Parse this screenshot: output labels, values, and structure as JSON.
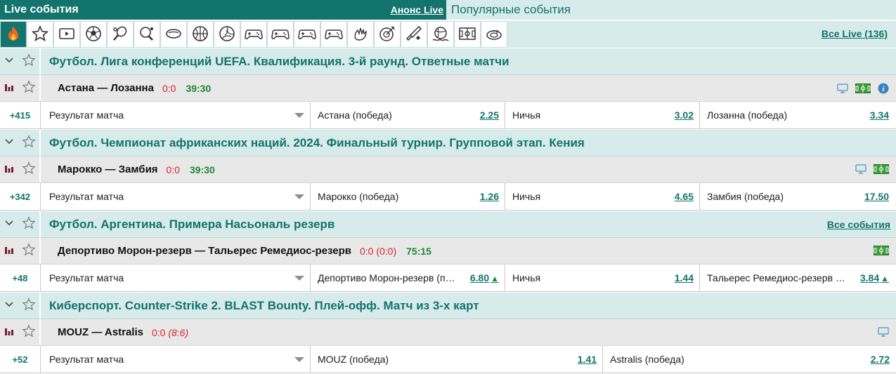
{
  "header": {
    "title": "Live события",
    "announce_link": "Анонс Live",
    "popular_title": "Популярные события"
  },
  "sports_bar": {
    "icons": [
      "fire-icon",
      "star-icon",
      "video-icon",
      "football-icon",
      "tennis-icon",
      "table-tennis-icon",
      "hockey-icon",
      "basketball-icon",
      "volleyball-icon",
      "esports-icon",
      "esports-icon",
      "esports-icon",
      "esports-icon",
      "handball-icon",
      "darts-icon",
      "cricket-icon",
      "water-polo-icon",
      "futsal-icon",
      "curling-icon"
    ],
    "all_live": "Все Live (136)"
  },
  "tournaments": [
    {
      "name": "Футбол. Лига конференций UEFA. Квалификация. 3-й раунд. Ответные матчи",
      "all_events": "",
      "match": {
        "teams": "Астана — Лозанна",
        "score": "0:0",
        "score_extra": "",
        "time": "39:30",
        "icons": [
          "tv-icon",
          "field-icon",
          "info-icon"
        ]
      },
      "odds": {
        "more": "+415",
        "market": "Результат матча",
        "outcomes": [
          {
            "label": "Астана (победа)",
            "coef": "2.25",
            "trend": ""
          },
          {
            "label": "Ничья",
            "coef": "3.02",
            "trend": ""
          },
          {
            "label": "Лозанна (победа)",
            "coef": "3.34",
            "trend": ""
          }
        ]
      }
    },
    {
      "name": "Футбол. Чемпионат африканских наций. 2024. Финальный турнир. Групповой этап. Кения",
      "all_events": "",
      "match": {
        "teams": "Марокко — Замбия",
        "score": "0:0",
        "score_extra": "",
        "time": "39:30",
        "icons": [
          "tv-icon",
          "field-icon"
        ]
      },
      "odds": {
        "more": "+342",
        "market": "Результат матча",
        "outcomes": [
          {
            "label": "Марокко (победа)",
            "coef": "1.26",
            "trend": ""
          },
          {
            "label": "Ничья",
            "coef": "4.65",
            "trend": ""
          },
          {
            "label": "Замбия (победа)",
            "coef": "17.50",
            "trend": ""
          }
        ]
      }
    },
    {
      "name": "Футбол. Аргентина. Примера Насьональ резерв",
      "all_events": "Все события",
      "match": {
        "teams": "Депортиво Морон-резерв — Тальерес Ремедиос-резерв",
        "score": "0:0",
        "score_extra": "(0:0)",
        "time": "75:15",
        "icons": [
          "field-icon"
        ]
      },
      "odds": {
        "more": "+48",
        "market": "Результат матча",
        "outcomes": [
          {
            "label": "Депортиво Морон-резерв (п…",
            "coef": "6.80",
            "trend": "▲"
          },
          {
            "label": "Ничья",
            "coef": "1.44",
            "trend": ""
          },
          {
            "label": "Тальерес Ремедиос-резерв …",
            "coef": "3.84",
            "trend": "▲"
          }
        ]
      }
    },
    {
      "name": "Киберспорт. Counter-Strike 2. BLAST Bounty. Плей-офф. Матч из 3-х карт",
      "all_events": "",
      "match": {
        "teams": "MOUZ — Astralis",
        "score": "0:0",
        "score_extra": "(8:6)",
        "time": "",
        "icons": [
          "tv-icon"
        ]
      },
      "odds": {
        "more": "+52",
        "market": "Результат матча",
        "outcomes": [
          {
            "label": "MOUZ (победа)",
            "coef": "1.41",
            "trend": ""
          },
          {
            "label": "Astralis (победа)",
            "coef": "2.72",
            "trend": ""
          }
        ]
      }
    }
  ],
  "colors": {
    "brand": "#12746c",
    "header_bg": "#d6ebea",
    "match_bg": "#e8e8e8",
    "score": "#d8222a",
    "time": "#1a8a34"
  }
}
